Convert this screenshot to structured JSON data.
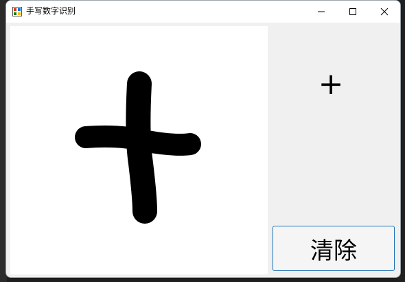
{
  "window": {
    "title": "手写数字识别",
    "icon": "app-icon"
  },
  "caption_buttons": {
    "minimize_icon": "minimize-icon",
    "maximize_icon": "maximize-icon",
    "close_icon": "close-icon"
  },
  "canvas": {
    "drawing_color": "#000000",
    "background": "#ffffff"
  },
  "result": {
    "text": "+"
  },
  "clear_button": {
    "label": "清除"
  },
  "colors": {
    "window_bg": "#f0f0f0",
    "button_border": "#1b6fb5"
  }
}
